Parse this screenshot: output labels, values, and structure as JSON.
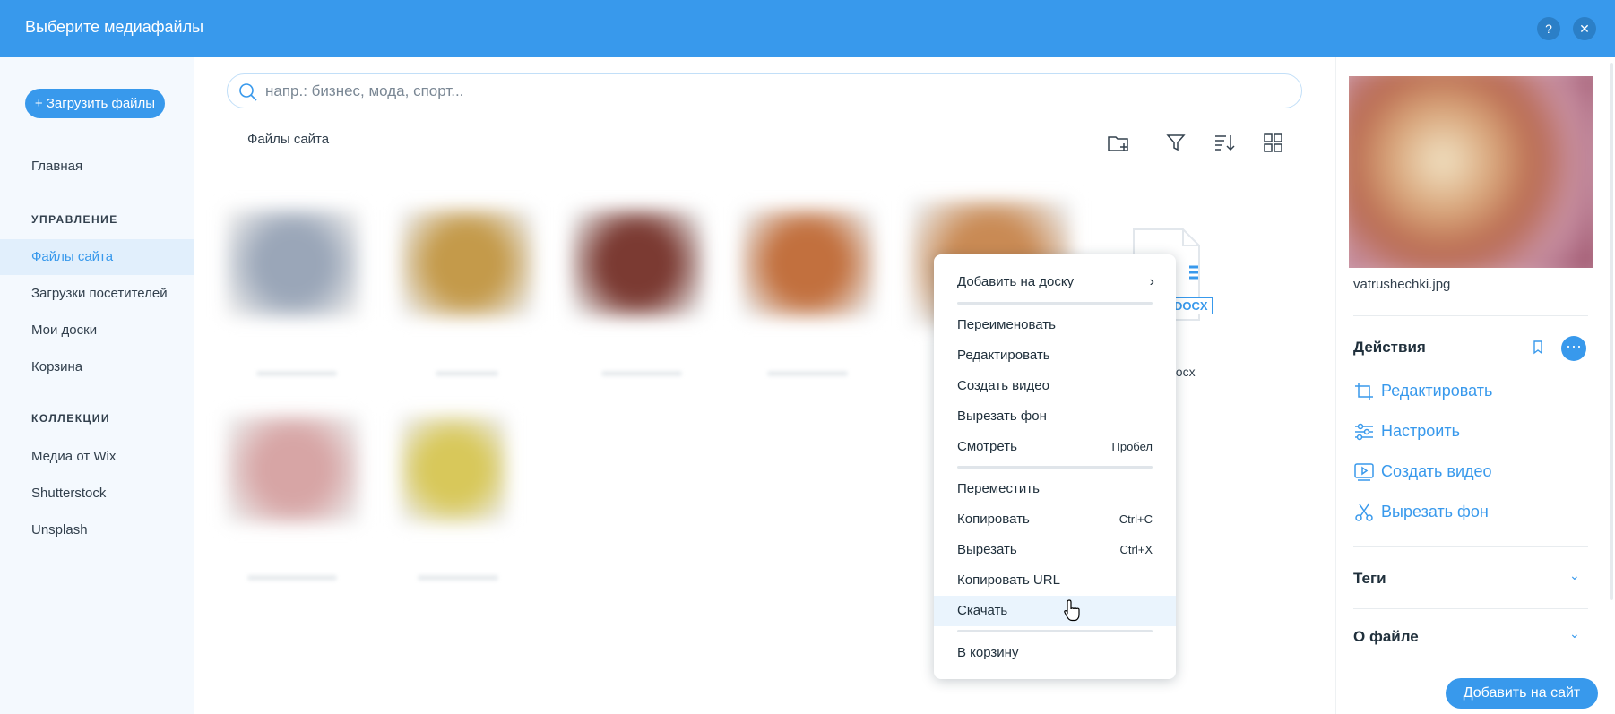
{
  "header": {
    "title": "Выберите медиафайлы",
    "help_label": "?",
    "close_label": "✕"
  },
  "sidebar": {
    "upload_label": "+ Загрузить файлы",
    "home_label": "Главная",
    "manage_section": "УПРАВЛЕНИЕ",
    "manage_items": [
      {
        "label": "Файлы сайта",
        "active": true
      },
      {
        "label": "Загрузки посетителей",
        "active": false
      },
      {
        "label": "Мои доски",
        "active": false
      },
      {
        "label": "Корзина",
        "active": false
      }
    ],
    "collections_section": "КОЛЛЕКЦИИ",
    "collection_items": [
      {
        "label": "Медиа от Wix"
      },
      {
        "label": "Shutterstock"
      },
      {
        "label": "Unsplash"
      }
    ]
  },
  "main": {
    "search_placeholder": "напр.: бизнес, мода, спорт...",
    "breadcrumb": "Файлы сайта",
    "doc_badge": "DOCX",
    "doc_name": "docx",
    "thumbnail_colors": [
      "#9aa6b8",
      "#c49a4a",
      "#7b3a32",
      "#c2703e",
      "#c98a54",
      "#d7a5a5",
      "#d8c85a"
    ]
  },
  "context_menu": {
    "groups": [
      [
        {
          "label": "Добавить на доску",
          "submenu": true,
          "shortcut": ""
        }
      ],
      [
        {
          "label": "Переименовать",
          "shortcut": ""
        },
        {
          "label": "Редактировать",
          "shortcut": ""
        },
        {
          "label": "Создать видео",
          "shortcut": ""
        },
        {
          "label": "Вырезать фон",
          "shortcut": ""
        },
        {
          "label": "Смотреть",
          "shortcut": "Пробел"
        }
      ],
      [
        {
          "label": "Переместить",
          "shortcut": ""
        },
        {
          "label": "Копировать",
          "shortcut": "Ctrl+C"
        },
        {
          "label": "Вырезать",
          "shortcut": "Ctrl+X"
        },
        {
          "label": "Копировать URL",
          "shortcut": ""
        },
        {
          "label": "Скачать",
          "shortcut": "",
          "highlighted": true
        }
      ],
      [
        {
          "label": "В корзину",
          "shortcut": ""
        }
      ]
    ],
    "submenu_arrow": "›"
  },
  "details": {
    "file_name": "vatrushechki.jpg",
    "actions_heading": "Действия",
    "more_label": "···",
    "actions": [
      {
        "label": "Редактировать",
        "icon": "crop-icon"
      },
      {
        "label": "Настроить",
        "icon": "sliders-icon"
      },
      {
        "label": "Создать видео",
        "icon": "video-icon"
      },
      {
        "label": "Вырезать фон",
        "icon": "scissors-icon"
      }
    ],
    "tags_heading": "Теги",
    "about_heading": "О файле",
    "chevron": "⌄"
  },
  "footer": {
    "add_label": "Добавить на сайт"
  },
  "colors": {
    "accent": "#3899ec",
    "sidebar_bg": "#f4f9fe",
    "active_bg": "#e1effc"
  }
}
